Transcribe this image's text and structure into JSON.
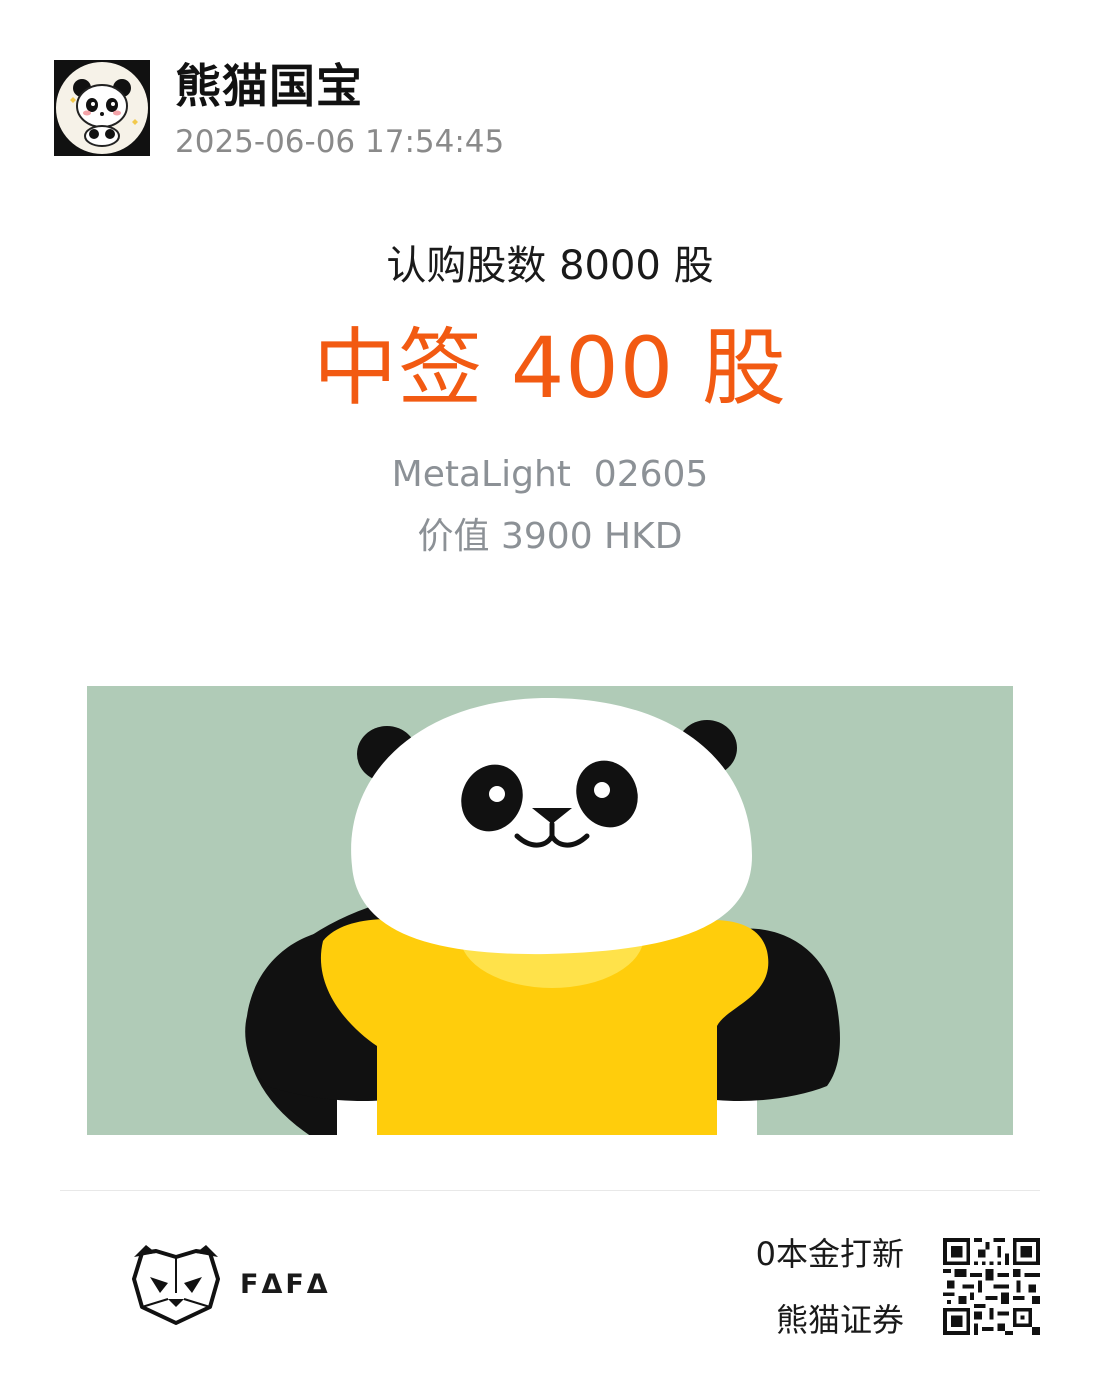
{
  "header": {
    "username": "熊猫国宝",
    "timestamp": "2025-06-06 17:54:45",
    "avatar_icon": "panda-avatar-icon"
  },
  "result": {
    "subscribed_text": "认购股数 8000 股",
    "allotted_text": "中签 400 股",
    "stock_line": "MetaLight  02605",
    "value_text": "价值 3900 HKD"
  },
  "illustration": {
    "icon": "panda-holding-gold-ingot-icon",
    "background_color": "#b0cbb7",
    "gold_color": "#ffcd0c"
  },
  "footer": {
    "brand_text": "FΔFΔ",
    "brand_icon": "panda-logo-icon",
    "slogan": "0本金打新",
    "company": "熊猫证券",
    "qr_icon": "qr-code-icon"
  },
  "colors": {
    "accent": "#f25a12",
    "muted_text": "#8c9196"
  }
}
